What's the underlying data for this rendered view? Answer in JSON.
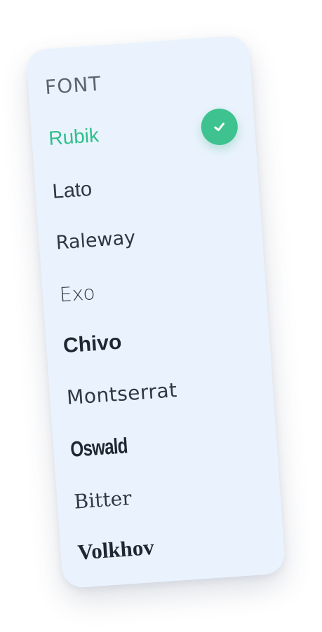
{
  "panel": {
    "title": "FONT",
    "selected": "Rubik",
    "accent_color": "#3ec28f",
    "check_icon": "checkmark-icon",
    "items": [
      {
        "label": "Rubik"
      },
      {
        "label": "Lato"
      },
      {
        "label": "Raleway"
      },
      {
        "label": "Exo"
      },
      {
        "label": "Chivo"
      },
      {
        "label": "Montserrat"
      },
      {
        "label": "Oswald"
      },
      {
        "label": "Bitter"
      },
      {
        "label": "Volkhov"
      }
    ]
  }
}
